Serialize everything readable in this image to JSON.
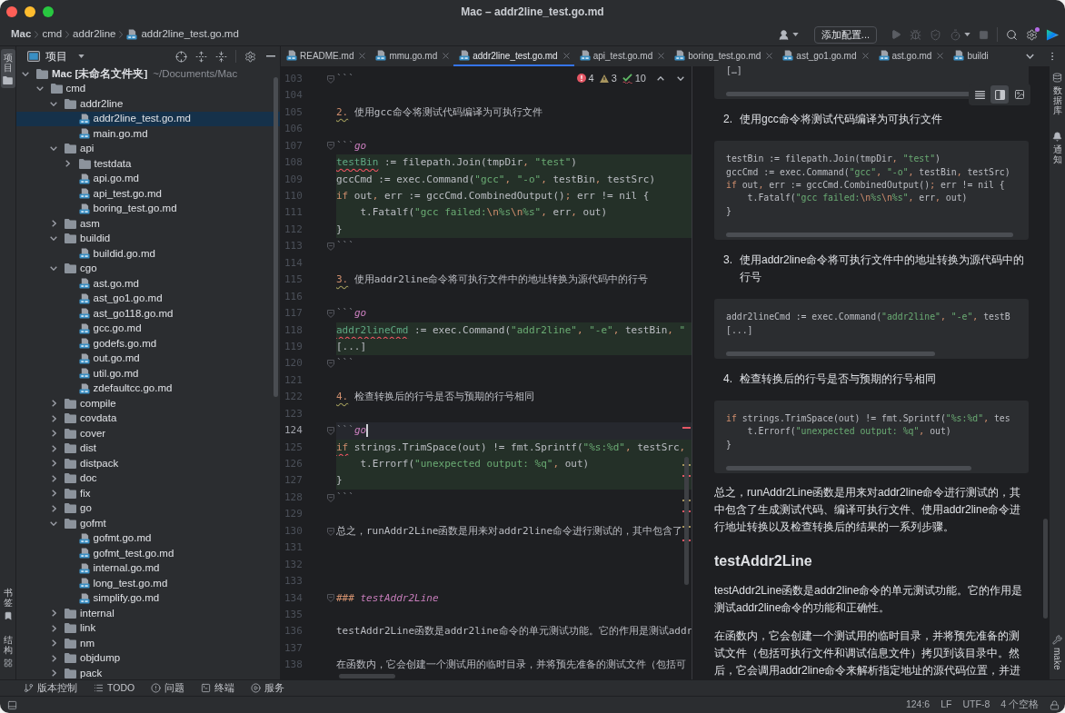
{
  "window": {
    "title": "Mac – addr2line_test.go.md"
  },
  "breadcrumb": [
    "Mac",
    "cmd",
    "addr2line",
    "addr2line_test.go.md"
  ],
  "toolbar": {
    "run_configuration": "添加配置..."
  },
  "left_strip": {
    "top": [
      {
        "label": "项目",
        "kind": "project",
        "selected": true
      }
    ],
    "bottom": [
      {
        "label": "书签",
        "kind": "bookmarks",
        "selected": false
      },
      {
        "label": "结构",
        "kind": "structure",
        "selected": false
      }
    ]
  },
  "project": {
    "title": "项目",
    "tree": [
      {
        "name": "Mac [未命名文件夹]",
        "location": "~/Documents/Mac",
        "kind": "folder",
        "expanded": true,
        "selected": false,
        "children": [
          {
            "name": "cmd",
            "kind": "folder",
            "expanded": true,
            "selected": false,
            "children": [
              {
                "name": "addr2line",
                "kind": "folder",
                "expanded": true,
                "selected": false,
                "children": [
                  {
                    "name": "addr2line_test.go.md",
                    "kind": "file",
                    "selected": true
                  },
                  {
                    "name": "main.go.md",
                    "kind": "file",
                    "selected": false
                  }
                ]
              },
              {
                "name": "api",
                "kind": "folder",
                "expanded": true,
                "selected": false,
                "children": [
                  {
                    "name": "testdata",
                    "kind": "folder",
                    "expanded": false,
                    "selected": false
                  },
                  {
                    "name": "api.go.md",
                    "kind": "file",
                    "selected": false
                  },
                  {
                    "name": "api_test.go.md",
                    "kind": "file",
                    "selected": false
                  },
                  {
                    "name": "boring_test.go.md",
                    "kind": "file",
                    "selected": false
                  }
                ]
              },
              {
                "name": "asm",
                "kind": "folder",
                "expanded": false,
                "selected": false
              },
              {
                "name": "buildid",
                "kind": "folder",
                "expanded": true,
                "selected": false,
                "children": [
                  {
                    "name": "buildid.go.md",
                    "kind": "file",
                    "selected": false
                  }
                ]
              },
              {
                "name": "cgo",
                "kind": "folder",
                "expanded": true,
                "selected": false,
                "children": [
                  {
                    "name": "ast.go.md",
                    "kind": "file",
                    "selected": false
                  },
                  {
                    "name": "ast_go1.go.md",
                    "kind": "file",
                    "selected": false
                  },
                  {
                    "name": "ast_go118.go.md",
                    "kind": "file",
                    "selected": false
                  },
                  {
                    "name": "gcc.go.md",
                    "kind": "file",
                    "selected": false
                  },
                  {
                    "name": "godefs.go.md",
                    "kind": "file",
                    "selected": false
                  },
                  {
                    "name": "out.go.md",
                    "kind": "file",
                    "selected": false
                  },
                  {
                    "name": "util.go.md",
                    "kind": "file",
                    "selected": false
                  },
                  {
                    "name": "zdefaultcc.go.md",
                    "kind": "file",
                    "selected": false
                  }
                ]
              },
              {
                "name": "compile",
                "kind": "folder",
                "expanded": false,
                "selected": false
              },
              {
                "name": "covdata",
                "kind": "folder",
                "expanded": false,
                "selected": false
              },
              {
                "name": "cover",
                "kind": "folder",
                "expanded": false,
                "selected": false
              },
              {
                "name": "dist",
                "kind": "folder",
                "expanded": false,
                "selected": false
              },
              {
                "name": "distpack",
                "kind": "folder",
                "expanded": false,
                "selected": false
              },
              {
                "name": "doc",
                "kind": "folder",
                "expanded": false,
                "selected": false
              },
              {
                "name": "fix",
                "kind": "folder",
                "expanded": false,
                "selected": false
              },
              {
                "name": "go",
                "kind": "folder",
                "expanded": false,
                "selected": false
              },
              {
                "name": "gofmt",
                "kind": "folder",
                "expanded": true,
                "selected": false,
                "children": [
                  {
                    "name": "gofmt.go.md",
                    "kind": "file",
                    "selected": false
                  },
                  {
                    "name": "gofmt_test.go.md",
                    "kind": "file",
                    "selected": false
                  },
                  {
                    "name": "internal.go.md",
                    "kind": "file",
                    "selected": false
                  },
                  {
                    "name": "long_test.go.md",
                    "kind": "file",
                    "selected": false
                  },
                  {
                    "name": "simplify.go.md",
                    "kind": "file",
                    "selected": false
                  }
                ]
              },
              {
                "name": "internal",
                "kind": "folder",
                "expanded": false,
                "selected": false
              },
              {
                "name": "link",
                "kind": "folder",
                "expanded": false,
                "selected": false
              },
              {
                "name": "nm",
                "kind": "folder",
                "expanded": false,
                "selected": false
              },
              {
                "name": "objdump",
                "kind": "folder",
                "expanded": false,
                "selected": false
              },
              {
                "name": "pack",
                "kind": "folder",
                "expanded": false,
                "selected": false
              }
            ]
          }
        ]
      }
    ]
  },
  "editor": {
    "tabs": [
      {
        "label": "README.md",
        "selected": false,
        "closable": true
      },
      {
        "label": "mmu.go.md",
        "selected": false,
        "closable": true
      },
      {
        "label": "addr2line_test.go.md",
        "selected": true,
        "closable": true
      },
      {
        "label": "api_test.go.md",
        "selected": false,
        "closable": true
      },
      {
        "label": "boring_test.go.md",
        "selected": false,
        "closable": true
      },
      {
        "label": "ast_go1.go.md",
        "selected": false,
        "closable": true
      },
      {
        "label": "ast.go.md",
        "selected": false,
        "closable": true
      },
      {
        "label": "buildi",
        "selected": false,
        "closable": false
      }
    ],
    "inspections": {
      "errors": "4",
      "warnings": "3",
      "typos": "10"
    },
    "lines": [
      {
        "number": "103",
        "kind": "prose",
        "fold": true,
        "current": false,
        "parts": [
          {
            "text": "```",
            "kind": "fence"
          }
        ]
      },
      {
        "number": "104",
        "kind": "prose",
        "fold": false,
        "current": false
      },
      {
        "number": "105",
        "kind": "prose",
        "fold": false,
        "current": false,
        "parts": [
          {
            "text": "2.",
            "kind": "list-number"
          },
          {
            "text": " 使用gcc命令将测试代码编译为可执行文件",
            "kind": "plain"
          }
        ]
      },
      {
        "number": "106",
        "kind": "prose",
        "fold": false,
        "current": false
      },
      {
        "number": "107",
        "kind": "prose",
        "fold": true,
        "current": false,
        "parts": [
          {
            "text": "```",
            "kind": "fence"
          },
          {
            "text": "go",
            "kind": "language"
          }
        ]
      },
      {
        "number": "108",
        "kind": "code",
        "fold": false,
        "current": false,
        "parts": [
          {
            "text": "testBin",
            "kind": "unresolved"
          },
          {
            "text": " := filepath.Join(tmpDir",
            "kind": "plain"
          },
          {
            "text": ", ",
            "kind": "punct"
          },
          {
            "text": "\"test\"",
            "kind": "string"
          },
          {
            "text": ")",
            "kind": "plain"
          }
        ]
      },
      {
        "number": "109",
        "kind": "code",
        "fold": false,
        "current": false,
        "parts": [
          {
            "text": "gccCmd := exec.Command(",
            "kind": "plain"
          },
          {
            "text": "\"gcc\"",
            "kind": "string"
          },
          {
            "text": ", ",
            "kind": "punct"
          },
          {
            "text": "\"-o\"",
            "kind": "string"
          },
          {
            "text": ", ",
            "kind": "punct"
          },
          {
            "text": "testBin",
            "kind": "plain"
          },
          {
            "text": ", ",
            "kind": "punct"
          },
          {
            "text": "testSrc)",
            "kind": "plain"
          }
        ]
      },
      {
        "number": "110",
        "kind": "code",
        "fold": false,
        "current": false,
        "parts": [
          {
            "text": "if",
            "kind": "keyword"
          },
          {
            "text": " out",
            "kind": "plain"
          },
          {
            "text": ", ",
            "kind": "punct"
          },
          {
            "text": "err := gccCmd.CombinedOutput()",
            "kind": "plain"
          },
          {
            "text": ";",
            "kind": "punct"
          },
          {
            "text": " err != nil {",
            "kind": "plain"
          }
        ]
      },
      {
        "number": "111",
        "kind": "code",
        "fold": false,
        "current": false,
        "parts": [
          {
            "text": "    t.Fatalf(",
            "kind": "plain"
          },
          {
            "text": "\"gcc failed:",
            "kind": "string"
          },
          {
            "text": "\\n",
            "kind": "escape"
          },
          {
            "text": "%s",
            "kind": "string"
          },
          {
            "text": "\\n",
            "kind": "escape"
          },
          {
            "text": "%s\"",
            "kind": "string"
          },
          {
            "text": ", ",
            "kind": "punct"
          },
          {
            "text": "err",
            "kind": "plain"
          },
          {
            "text": ", ",
            "kind": "punct"
          },
          {
            "text": "out)",
            "kind": "plain"
          }
        ]
      },
      {
        "number": "112",
        "kind": "code",
        "fold": false,
        "current": false,
        "parts": [
          {
            "text": "}",
            "kind": "plain"
          }
        ]
      },
      {
        "number": "113",
        "kind": "prose",
        "fold": true,
        "current": false,
        "parts": [
          {
            "text": "```",
            "kind": "fence"
          }
        ]
      },
      {
        "number": "114",
        "kind": "prose",
        "fold": false,
        "current": false
      },
      {
        "number": "115",
        "kind": "prose",
        "fold": false,
        "current": false,
        "parts": [
          {
            "text": "3.",
            "kind": "list-number"
          },
          {
            "text": " 使用addr2line命令将可执行文件中的地址转换为源代码中的行号",
            "kind": "plain"
          }
        ]
      },
      {
        "number": "116",
        "kind": "prose",
        "fold": false,
        "current": false
      },
      {
        "number": "117",
        "kind": "prose",
        "fold": true,
        "current": false,
        "parts": [
          {
            "text": "```",
            "kind": "fence"
          },
          {
            "text": "go",
            "kind": "language"
          }
        ]
      },
      {
        "number": "118",
        "kind": "code",
        "fold": false,
        "current": false,
        "parts": [
          {
            "text": "addr2lineCmd",
            "kind": "unresolved"
          },
          {
            "text": " := exec.Command(",
            "kind": "plain"
          },
          {
            "text": "\"addr2line\"",
            "kind": "string"
          },
          {
            "text": ", ",
            "kind": "punct"
          },
          {
            "text": "\"-e\"",
            "kind": "string"
          },
          {
            "text": ", ",
            "kind": "punct"
          },
          {
            "text": "testBin",
            "kind": "plain"
          },
          {
            "text": ", ",
            "kind": "punct"
          },
          {
            "text": "\"",
            "kind": "string"
          }
        ]
      },
      {
        "number": "119",
        "kind": "code",
        "fold": false,
        "current": false,
        "parts": [
          {
            "text": "[...]",
            "kind": "plain"
          }
        ]
      },
      {
        "number": "120",
        "kind": "prose",
        "fold": true,
        "current": false,
        "parts": [
          {
            "text": "```",
            "kind": "fence"
          }
        ]
      },
      {
        "number": "121",
        "kind": "prose",
        "fold": false,
        "current": false
      },
      {
        "number": "122",
        "kind": "prose",
        "fold": false,
        "current": false,
        "parts": [
          {
            "text": "4.",
            "kind": "list-number"
          },
          {
            "text": " 检查转换后的行号是否与预期的行号相同",
            "kind": "plain"
          }
        ]
      },
      {
        "number": "123",
        "kind": "prose",
        "fold": false,
        "current": false
      },
      {
        "number": "124",
        "kind": "prose",
        "fold": true,
        "current": true,
        "parts": [
          {
            "text": "```",
            "kind": "fence"
          },
          {
            "text": "go",
            "kind": "language"
          }
        ]
      },
      {
        "number": "125",
        "kind": "code",
        "fold": false,
        "current": false,
        "parts": [
          {
            "text": "if",
            "kind": "keyword-error"
          },
          {
            "text": " strings.TrimSpace(out) != fmt.Sprintf(",
            "kind": "plain"
          },
          {
            "text": "\"%s:%d\"",
            "kind": "string"
          },
          {
            "text": ", ",
            "kind": "punct"
          },
          {
            "text": "testSrc",
            "kind": "plain"
          },
          {
            "text": ",",
            "kind": "punct"
          }
        ]
      },
      {
        "number": "126",
        "kind": "code",
        "fold": false,
        "current": false,
        "parts": [
          {
            "text": "    t.Errorf(",
            "kind": "plain"
          },
          {
            "text": "\"unexpected output: %q\"",
            "kind": "string"
          },
          {
            "text": ", ",
            "kind": "punct"
          },
          {
            "text": "out)",
            "kind": "plain"
          }
        ]
      },
      {
        "number": "127",
        "kind": "code",
        "fold": false,
        "current": false,
        "parts": [
          {
            "text": "}",
            "kind": "plain"
          }
        ]
      },
      {
        "number": "128",
        "kind": "prose",
        "fold": true,
        "current": false,
        "parts": [
          {
            "text": "```",
            "kind": "fence"
          }
        ]
      },
      {
        "number": "129",
        "kind": "prose",
        "fold": false,
        "current": false
      },
      {
        "number": "130",
        "kind": "prose",
        "fold": true,
        "current": false,
        "parts": [
          {
            "text": "总之，runAddr2Line函数是用来对addr2line命令进行测试的，其中包含了",
            "kind": "plain"
          }
        ]
      },
      {
        "number": "131",
        "kind": "prose",
        "fold": false,
        "current": false
      },
      {
        "number": "132",
        "kind": "prose",
        "fold": false,
        "current": false
      },
      {
        "number": "133",
        "kind": "prose",
        "fold": false,
        "current": false
      },
      {
        "number": "134",
        "kind": "prose",
        "fold": true,
        "current": false,
        "parts": [
          {
            "text": "###",
            "kind": "heading-mark"
          },
          {
            "text": " testAddr2Line",
            "kind": "heading"
          }
        ]
      },
      {
        "number": "135",
        "kind": "prose",
        "fold": false,
        "current": false
      },
      {
        "number": "136",
        "kind": "prose",
        "fold": false,
        "current": false,
        "parts": [
          {
            "text": "testAddr2Line函数是addr2line命令的单元测试功能。它的作用是测试addr",
            "kind": "plain"
          }
        ]
      },
      {
        "number": "137",
        "kind": "prose",
        "fold": false,
        "current": false
      },
      {
        "number": "138",
        "kind": "prose",
        "fold": false,
        "current": false,
        "parts": [
          {
            "text": "在函数内，它会创建一个测试用的临时目录，并将预先准备的测试文件（包括可",
            "kind": "plain"
          }
        ]
      }
    ]
  },
  "preview": {
    "view_modes": [
      {
        "kind": "editor",
        "selected": false
      },
      {
        "kind": "split",
        "selected": true
      },
      {
        "kind": "preview",
        "selected": false
      }
    ],
    "blocks": [
      {
        "kind": "code",
        "lines": [
          [
            {
              "text": "[…]",
              "kind": "plain"
            }
          ]
        ]
      },
      {
        "kind": "list-item",
        "number": "2.",
        "text": "使用gcc命令将测试代码编译为可执行文件"
      },
      {
        "kind": "code",
        "lines": [
          [
            {
              "text": "testBin := filepath.Join(tmpDir",
              "kind": "plain"
            },
            {
              "text": ", ",
              "kind": "punct"
            },
            {
              "text": "\"test\"",
              "kind": "string"
            },
            {
              "text": ")",
              "kind": "plain"
            }
          ],
          [
            {
              "text": "gccCmd := exec.Command(",
              "kind": "plain"
            },
            {
              "text": "\"gcc\"",
              "kind": "string"
            },
            {
              "text": ", ",
              "kind": "punct"
            },
            {
              "text": "\"-o\"",
              "kind": "string"
            },
            {
              "text": ", ",
              "kind": "punct"
            },
            {
              "text": "testBin",
              "kind": "plain"
            },
            {
              "text": ", ",
              "kind": "punct"
            },
            {
              "text": "testSrc)",
              "kind": "plain"
            }
          ],
          [
            {
              "text": "if",
              "kind": "keyword"
            },
            {
              "text": " out",
              "kind": "plain"
            },
            {
              "text": ", ",
              "kind": "punct"
            },
            {
              "text": "err := gccCmd.CombinedOutput()",
              "kind": "plain"
            },
            {
              "text": ";",
              "kind": "punct"
            },
            {
              "text": " err != nil {",
              "kind": "plain"
            }
          ],
          [
            {
              "text": "    t.Fatalf(",
              "kind": "plain"
            },
            {
              "text": "\"gcc failed:",
              "kind": "string"
            },
            {
              "text": "\\n",
              "kind": "escape"
            },
            {
              "text": "%s",
              "kind": "string"
            },
            {
              "text": "\\n",
              "kind": "escape"
            },
            {
              "text": "%s\"",
              "kind": "string"
            },
            {
              "text": ", ",
              "kind": "punct"
            },
            {
              "text": "err",
              "kind": "plain"
            },
            {
              "text": ", ",
              "kind": "punct"
            },
            {
              "text": "out)",
              "kind": "plain"
            }
          ],
          [
            {
              "text": "}",
              "kind": "plain"
            }
          ]
        ]
      },
      {
        "kind": "list-item",
        "number": "3.",
        "text": "使用addr2line命令将可执行文件中的地址转换为源代码中的行号"
      },
      {
        "kind": "code",
        "lines": [
          [
            {
              "text": "addr2lineCmd := exec.Command(",
              "kind": "plain"
            },
            {
              "text": "\"addr2line\"",
              "kind": "string"
            },
            {
              "text": ", ",
              "kind": "punct"
            },
            {
              "text": "\"-e\"",
              "kind": "string"
            },
            {
              "text": ", ",
              "kind": "punct"
            },
            {
              "text": "testB",
              "kind": "plain"
            }
          ],
          [
            {
              "text": "[...]",
              "kind": "plain"
            }
          ]
        ]
      },
      {
        "kind": "list-item",
        "number": "4.",
        "text": "检查转换后的行号是否与预期的行号相同"
      },
      {
        "kind": "code",
        "lines": [
          [
            {
              "text": "if",
              "kind": "keyword"
            },
            {
              "text": " strings.TrimSpace(out) != fmt.Sprintf(",
              "kind": "plain"
            },
            {
              "text": "\"%s:%d\"",
              "kind": "string"
            },
            {
              "text": ", ",
              "kind": "punct"
            },
            {
              "text": "tes",
              "kind": "plain"
            }
          ],
          [
            {
              "text": "    t.Errorf(",
              "kind": "plain"
            },
            {
              "text": "\"unexpected output: %q\"",
              "kind": "string"
            },
            {
              "text": ", ",
              "kind": "punct"
            },
            {
              "text": "out)",
              "kind": "plain"
            }
          ],
          [
            {
              "text": "}",
              "kind": "plain"
            }
          ]
        ]
      },
      {
        "kind": "paragraph",
        "text": "总之，runAddr2Line函数是用来对addr2line命令进行测试的，其中包含了生成测试代码、编译可执行文件、使用addr2line命令进行地址转换以及检查转换后的结果的一系列步骤。"
      },
      {
        "kind": "heading",
        "text": "testAddr2Line"
      },
      {
        "kind": "paragraph",
        "text": "testAddr2Line函数是addr2line命令的单元测试功能。它的作用是测试addr2line命令的功能和正确性。"
      },
      {
        "kind": "paragraph",
        "text": "在函数内，它会创建一个测试用的临时目录，并将预先准备的测试文件（包括可执行文件和调试信息文件）拷贝到该目录中。然后，它会调用addr2line命令来解析指定地址的源代码位置，并进"
      }
    ]
  },
  "right_strip": {
    "top": [
      {
        "label": "数据库",
        "kind": "database"
      },
      {
        "label": "通知",
        "kind": "notifications"
      }
    ],
    "bottom": [
      {
        "label": "make",
        "kind": "make"
      }
    ]
  },
  "tool_bar": [
    {
      "label": "版本控制",
      "kind": "vcs"
    },
    {
      "label": "TODO",
      "kind": "todo"
    },
    {
      "label": "问题",
      "kind": "problems"
    },
    {
      "label": "终端",
      "kind": "terminal"
    },
    {
      "label": "服务",
      "kind": "services"
    }
  ],
  "status_bar": {
    "position": "124:6",
    "line_separator": "LF",
    "encoding": "UTF-8",
    "indent": "4 个空格"
  }
}
